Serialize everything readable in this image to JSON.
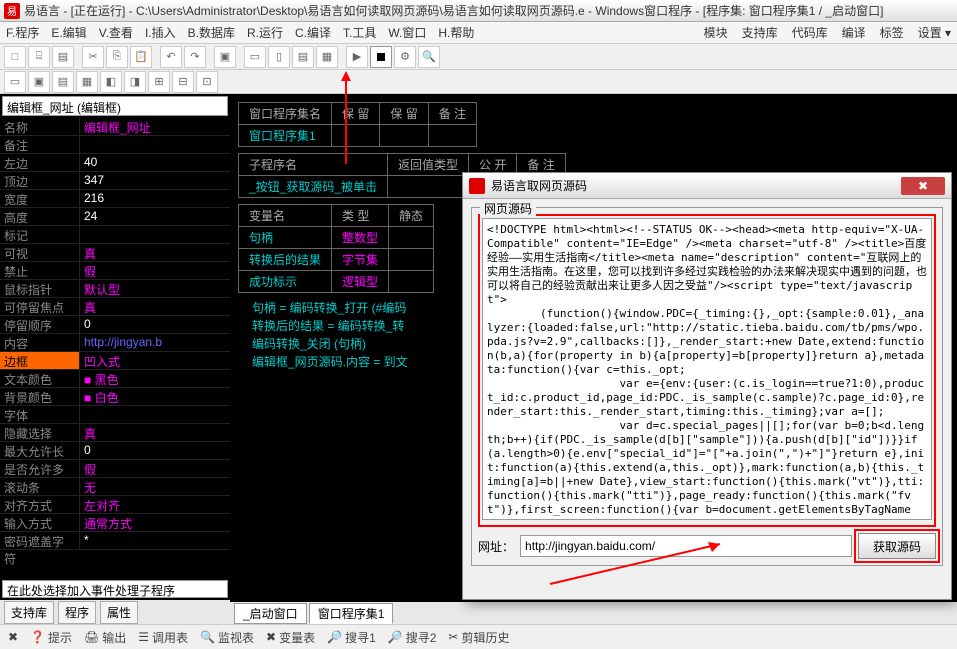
{
  "window": {
    "title": "易语言 - [正在运行] - C:\\Users\\Administrator\\Desktop\\易语言如何读取网页源码\\易语言如何读取网页源码.e - Windows窗口程序 - [程序集: 窗口程序集1 / _启动窗口]"
  },
  "menu": {
    "items": [
      "F.程序",
      "E.编辑",
      "V.查看",
      "I.插入",
      "B.数据库",
      "R.运行",
      "C.编译",
      "T.工具",
      "W.窗口",
      "H.帮助"
    ],
    "right": [
      "模块",
      "支持库",
      "代码库",
      "编译",
      "标签",
      "设置 ▾"
    ]
  },
  "left": {
    "combo": "编辑框_网址 (编辑框)",
    "props": [
      {
        "k": "名称",
        "v": "编辑框_网址",
        "c": "magenta"
      },
      {
        "k": "备注",
        "v": "",
        "c": "white"
      },
      {
        "k": "左边",
        "v": "40",
        "c": "white"
      },
      {
        "k": "顶边",
        "v": "347",
        "c": "white"
      },
      {
        "k": "宽度",
        "v": "216",
        "c": "white"
      },
      {
        "k": "高度",
        "v": "24",
        "c": "white"
      },
      {
        "k": "标记",
        "v": "",
        "c": "white"
      },
      {
        "k": "可视",
        "v": "真",
        "c": "magenta"
      },
      {
        "k": "禁止",
        "v": "假",
        "c": "magenta"
      },
      {
        "k": "鼠标指针",
        "v": "默认型",
        "c": "magenta"
      },
      {
        "k": "可停留焦点",
        "v": "真",
        "c": "magenta"
      },
      {
        "k": "停留顺序",
        "v": "0",
        "c": "white"
      },
      {
        "k": "内容",
        "v": "http://jingyan.b",
        "c": "blue"
      },
      {
        "k": "边框",
        "v": "凹入式",
        "c": "magenta",
        "sel": true
      },
      {
        "k": "文本颜色",
        "v": "■ 黑色",
        "c": "magenta"
      },
      {
        "k": "背景颜色",
        "v": "■ 白色",
        "c": "magenta"
      },
      {
        "k": "字体",
        "v": "",
        "c": "white"
      },
      {
        "k": "隐藏选择",
        "v": "真",
        "c": "magenta"
      },
      {
        "k": "最大允许长度",
        "v": "0",
        "c": "white"
      },
      {
        "k": "是否允许多行",
        "v": "假",
        "c": "magenta"
      },
      {
        "k": "滚动条",
        "v": "无",
        "c": "magenta"
      },
      {
        "k": "对齐方式",
        "v": "左对齐",
        "c": "magenta"
      },
      {
        "k": "输入方式",
        "v": "通常方式",
        "c": "magenta"
      },
      {
        "k": "密码遮盖字符",
        "v": "*",
        "c": "white"
      }
    ],
    "event_combo": "在此处选择加入事件处理子程序",
    "tabs": [
      "支持库",
      "程序",
      "属性"
    ]
  },
  "center": {
    "t1": {
      "headers": [
        "窗口程序集名",
        "保 留",
        "保 留",
        "备 注"
      ],
      "row": [
        "窗口程序集1",
        "",
        "",
        ""
      ]
    },
    "t2": {
      "headers": [
        "子程序名",
        "返回值类型",
        "公 开",
        "备 注"
      ],
      "row": [
        "_按钮_获取源码_被单击",
        "",
        "",
        ""
      ]
    },
    "t3": {
      "headers": [
        "变量名",
        "类 型",
        "静态"
      ],
      "rows": [
        [
          "句柄",
          "整数型",
          ""
        ],
        [
          "转换后的结果",
          "字节集",
          ""
        ],
        [
          "成功标示",
          "逻辑型",
          ""
        ]
      ]
    },
    "code": [
      "句柄 = 编码转换_打开 (#编码",
      "转换后的结果 = 编码转换_转",
      "编码转换_关闭 (句柄)",
      "编辑框_网页源码.内容 = 到文"
    ],
    "tabs": [
      "_启动窗口",
      "窗口程序集1"
    ]
  },
  "dialog": {
    "title": "易语言取网页源码",
    "group": "网页源码",
    "source": "<!DOCTYPE html><html><!--STATUS OK--><head><meta http-equiv=\"X-UA-Compatible\" content=\"IE=Edge\" /><meta charset=\"utf-8\" /><title>百度经验——实用生活指南</title><meta name=\"description\" content=\"互联网上的实用生活指南。在这里，您可以找到许多经过实践检验的办法来解决现实中遇到的问题，也可以将自己的经验贡献出来让更多人因之受益\"/><script type=\"text/javascript\">\n        (function(){window.PDC={_timing:{},_opt:{sample:0.01},_analyzer:{loaded:false,url:\"http://static.tieba.baidu.com/tb/pms/wpo.pda.js?v=2.9\",callbacks:[]},_render_start:+new Date,extend:function(b,a){for(property in b){a[property]=b[property]}return a},metadata:function(){var c=this._opt;\n                    var e={env:{user:(c.is_login==true?1:0),product_id:c.product_id,page_id:PDC._is_sample(c.sample)?c.page_id:0},render_start:this._render_start,timing:this._timing};var a=[];\n                    var d=c.special_pages||[];for(var b=0;b<d.length;b++){if(PDC._is_sample(d[b][\"sample\"])){a.push(d[b][\"id\"])}}if(a.length>0){e.env[\"special_id\"]=\"[\"+a.join(\",\")+\"]\"}return e},init:function(a){this.extend(a,this._opt)},mark:function(a,b){this._timing[a]=b||+new Date},view_start:function(){this.mark(\"vt\")},tti:function(){this.mark(\"tti\")},page_ready:function(){this.mark(\"fvt\")},first_screen:function(){var b=document.getElementsByTagName(\"img\"),g=document.getElementsByTagName(\"IFRAME\"),c=+new Date;",
    "url_label": "网址：",
    "url": "http://jingyan.baidu.com/",
    "button": "获取源码"
  },
  "status": {
    "items": [
      "提示",
      "输出",
      "调用表",
      "监视表",
      "变量表",
      "搜寻1",
      "搜寻2",
      "剪辑历史"
    ]
  }
}
